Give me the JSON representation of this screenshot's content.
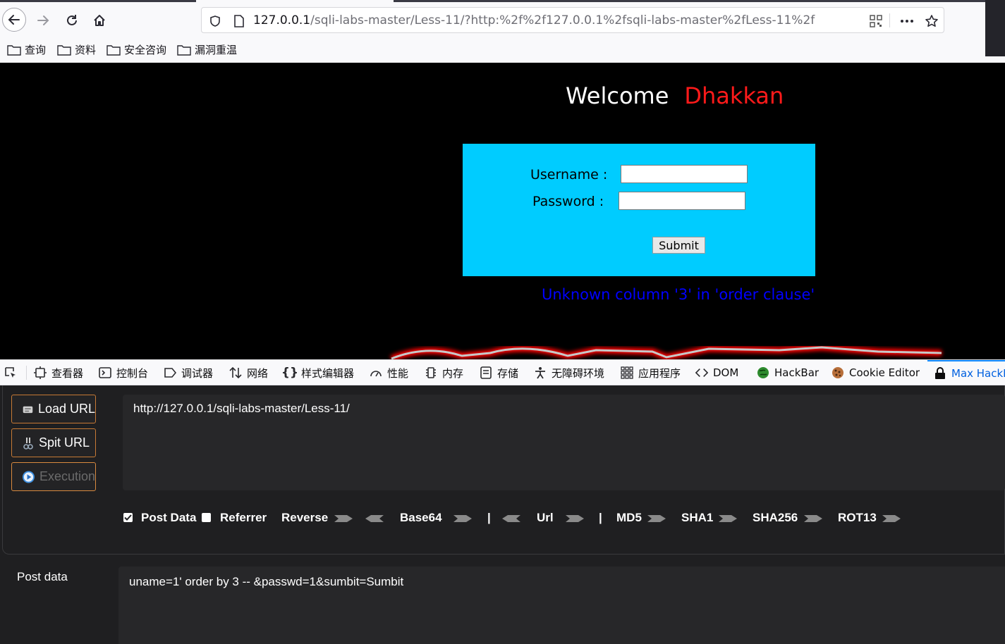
{
  "browser": {
    "url_host": "127.0.0.1",
    "url_path": "/sqli-labs-master/Less-11/?http:%2f%2f127.0.0.1%2fsqli-labs-master%2fLess-11%2f",
    "bookmarks": [
      "查询",
      "资料",
      "安全咨询",
      "漏洞重温"
    ],
    "icons": [
      "back-arrow-icon",
      "forward-arrow-icon",
      "reload-icon",
      "home-icon",
      "shield-icon",
      "page-icon",
      "qr-code-icon",
      "more-icon",
      "star-icon",
      "folder-icon"
    ]
  },
  "page": {
    "welcome": "Welcome",
    "name": "Dhakkan",
    "username_label": "Username :",
    "password_label": "Password :",
    "submit_label": "Submit",
    "error": "Unknown column '3' in 'order clause'",
    "colors": {
      "background": "#000000",
      "form": "#00ccff",
      "name": "#ff1a1a",
      "error": "#0000ff"
    }
  },
  "devtools": {
    "tabs": [
      "查看器",
      "控制台",
      "调试器",
      "网络",
      "样式编辑器",
      "性能",
      "内存",
      "存储",
      "无障碍环境",
      "应用程序",
      "DOM",
      "HackBar",
      "Cookie Editor",
      "Max HackBar"
    ],
    "selected_tab": "Max HackBar"
  },
  "hackbar": {
    "buttons": {
      "load": "Load URL",
      "split": "Spit URL",
      "exec": "Execution"
    },
    "url_value": "http://127.0.0.1/sqli-labs-master/Less-11/",
    "options": {
      "post_data": "Post Data",
      "post_data_checked": true,
      "referrer": "Referrer",
      "referrer_checked": false,
      "reverse": "Reverse",
      "base64": "Base64",
      "sep": "|",
      "url": "Url",
      "md5": "MD5",
      "sha1": "SHA1",
      "sha256": "SHA256",
      "rot13": "ROT13"
    },
    "post_label": "Post data",
    "post_value": "uname=1' order by 3 -- &passwd=1&sumbit=Sumbit"
  }
}
